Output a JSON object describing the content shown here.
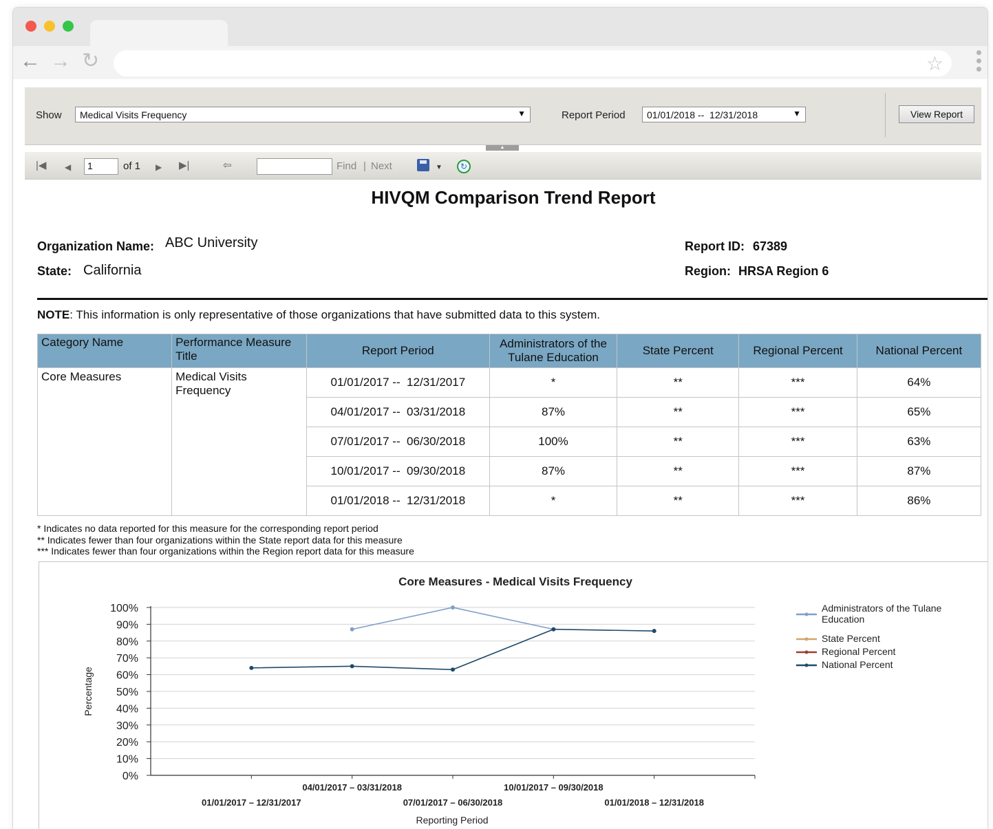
{
  "viewer": {
    "show_label": "Show",
    "show_value": "Medical Visits Frequency",
    "period_label": "Report Period",
    "period_value": "01/01/2018 --  12/31/2018",
    "view_report": "View Report",
    "page_number": "1",
    "page_of": "of 1",
    "find_label": "Find",
    "separator": "|",
    "next_label": "Next"
  },
  "report": {
    "title": "HIVQM Comparison Trend Report",
    "org_label": "Organization Name:",
    "org_value": "ABC University",
    "state_label": "State:",
    "state_value": "California",
    "report_id_label": "Report ID:",
    "report_id_value": "67389",
    "region_label": "Region:",
    "region_value": "HRSA Region 6",
    "note_bold": "NOTE",
    "note_text": ": This information is only representative of those organizations that have submitted data to this system."
  },
  "table": {
    "headers": [
      "Category Name",
      "Performance Measure Title",
      "Report Period",
      "Administrators of the Tulane Education",
      "State Percent",
      "Regional Percent",
      "National Percent"
    ],
    "category": "Core Measures",
    "measure": "Medical Visits Frequency",
    "rows": [
      {
        "period": "01/01/2017 --  12/31/2017",
        "admin": "*",
        "state": "**",
        "regional": "***",
        "national": "64%"
      },
      {
        "period": "04/01/2017 --  03/31/2018",
        "admin": "87%",
        "state": "**",
        "regional": "***",
        "national": "65%"
      },
      {
        "period": "07/01/2017 --  06/30/2018",
        "admin": "100%",
        "state": "**",
        "regional": "***",
        "national": "63%"
      },
      {
        "period": "10/01/2017 --  09/30/2018",
        "admin": "87%",
        "state": "**",
        "regional": "***",
        "national": "87%"
      },
      {
        "period": "01/01/2018 --  12/31/2018",
        "admin": "*",
        "state": "**",
        "regional": "***",
        "national": "86%"
      }
    ]
  },
  "footnotes": [
    "* Indicates no data reported for this measure for the corresponding report period",
    "** Indicates fewer than four organizations within the State report data for this measure",
    "*** Indicates fewer than four organizations within the Region report data for this measure"
  ],
  "chart_data": {
    "type": "line",
    "title": "Core Measures - Medical Visits Frequency",
    "xlabel": "Reporting Period",
    "ylabel": "Percentage",
    "categories": [
      "01/01/2017 – 12/31/2017",
      "04/01/2017 – 03/31/2018",
      "07/01/2017 – 06/30/2018",
      "10/01/2017 – 09/30/2018",
      "01/01/2018 – 12/31/2018"
    ],
    "ylim": [
      0,
      100
    ],
    "yticks": [
      "0%",
      "10%",
      "20%",
      "30%",
      "40%",
      "50%",
      "60%",
      "70%",
      "80%",
      "90%",
      "100%"
    ],
    "grid": true,
    "legend_position": "right",
    "series": [
      {
        "name": "Administrators of the Tulane Education",
        "color": "#7f9fc9",
        "values": [
          null,
          87,
          100,
          87,
          null
        ]
      },
      {
        "name": "State Percent",
        "color": "#d4a46a",
        "values": [
          null,
          null,
          null,
          null,
          null
        ]
      },
      {
        "name": "Regional Percent",
        "color": "#a33a32",
        "values": [
          null,
          null,
          null,
          null,
          null
        ]
      },
      {
        "name": "National Percent",
        "color": "#1f4a6a",
        "values": [
          64,
          65,
          63,
          87,
          86
        ]
      }
    ]
  }
}
